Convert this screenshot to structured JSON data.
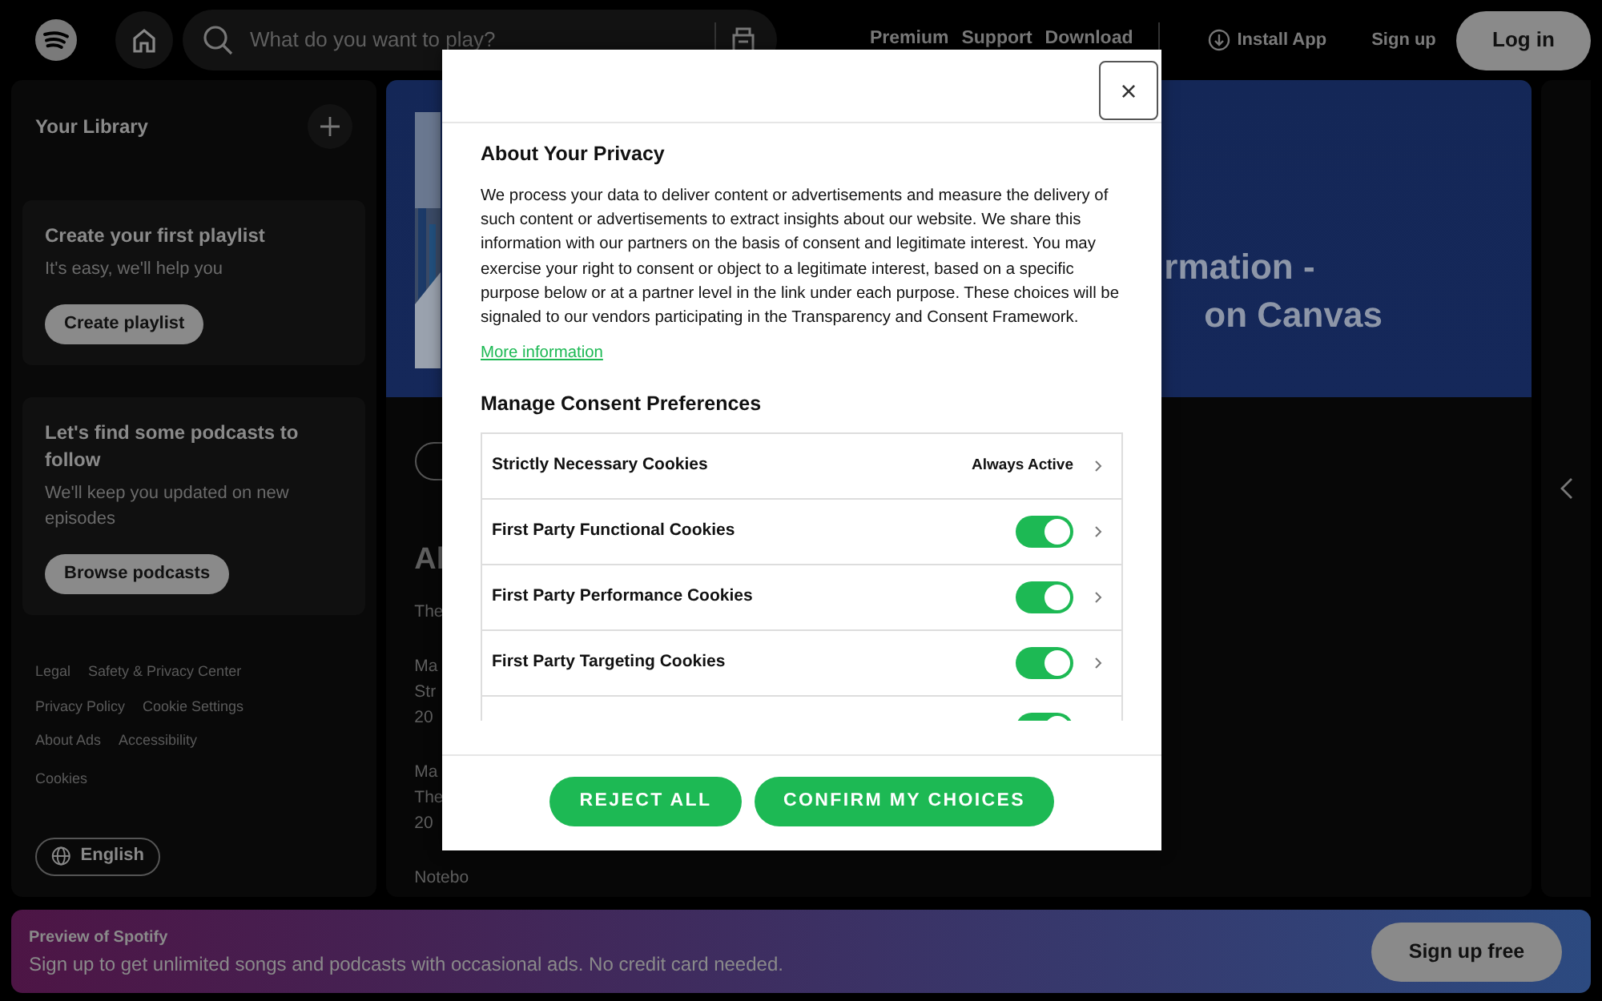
{
  "top_bar": {
    "search": {
      "placeholder": "What do you want to play?"
    },
    "links": [
      "Premium",
      "Support",
      "Download"
    ],
    "install_app": "Install App",
    "sign_up": "Sign up",
    "log_in": "Log in"
  },
  "sidebar": {
    "title": "Your Library",
    "cards": [
      {
        "title": "Create your first playlist",
        "text": "It's easy, we'll help you",
        "button": "Create playlist"
      },
      {
        "title": "Let's find some podcasts to follow",
        "text": "We'll keep you updated on new episodes",
        "button": "Browse podcasts"
      }
    ],
    "footer_links": [
      [
        "Legal",
        "Safety & Privacy Center"
      ],
      [
        "Privacy Policy",
        "Cookie Settings"
      ],
      [
        "About Ads",
        "Accessibility"
      ],
      [
        "Cookies"
      ]
    ],
    "language": "English"
  },
  "main": {
    "title_lines": [
      "rmation -",
      "on Canvas"
    ],
    "heading": "Al",
    "blocks": [
      [
        "The"
      ],
      [
        "Ma",
        "Str",
        "20"
      ],
      [
        "Ma",
        "The",
        "20"
      ],
      [
        "Notebo"
      ]
    ]
  },
  "modal": {
    "close": "×",
    "title": "About Your Privacy",
    "description": "We process your data to deliver content or advertisements and measure the delivery of such content or advertisements to extract insights about our website. We share this information with our partners on the basis of consent and legitimate interest. You may exercise your right to consent or object to a legitimate interest, based on a specific purpose below or at a partner level in the link under each purpose. These choices will be signaled to our vendors participating in the Transparency and Consent Framework.",
    "more_link": "More information",
    "prefs_title": "Manage Consent Preferences",
    "categories": [
      {
        "kind": "always",
        "name": "Strictly Necessary Cookies",
        "status": "Always Active"
      },
      {
        "kind": "toggle",
        "name": "First Party Functional Cookies",
        "on": true
      },
      {
        "kind": "toggle",
        "name": "First Party Performance Cookies",
        "on": true
      },
      {
        "kind": "toggle",
        "name": "First Party Targeting Cookies",
        "on": true
      },
      {
        "kind": "toggle",
        "on": true
      }
    ],
    "buttons": [
      "REJECT ALL",
      "CONFIRM MY CHOICES"
    ]
  },
  "banner": {
    "title": "Preview of Spotify",
    "text": "Sign up to get unlimited songs and podcasts with occasional ads. No credit card needed.",
    "button": "Sign up free"
  }
}
